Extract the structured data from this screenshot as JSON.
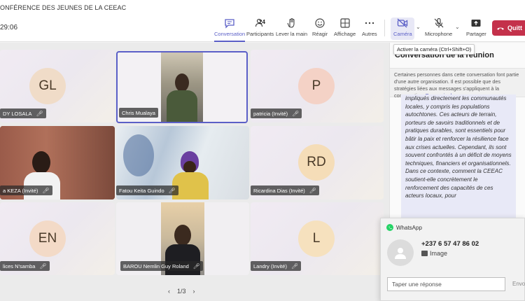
{
  "window": {
    "title": "ONFÉRENCE DES JEUNES DE LA CEEAC"
  },
  "toolbar": {
    "timer": "29:06",
    "items": [
      {
        "label": "Conversation",
        "icon": "chat-icon"
      },
      {
        "label": "Participants",
        "icon": "people-icon",
        "count": "24"
      },
      {
        "label": "Lever la main",
        "icon": "hand-icon"
      },
      {
        "label": "Réagir",
        "icon": "smile-icon"
      },
      {
        "label": "Affichage",
        "icon": "grid-icon"
      },
      {
        "label": "Autres",
        "icon": "more-icon"
      },
      {
        "label": "Caméra",
        "icon": "camera-off-icon"
      },
      {
        "label": "Microphone",
        "icon": "mic-off-icon"
      },
      {
        "label": "Partager",
        "icon": "share-icon"
      }
    ],
    "leave_label": "Quitt",
    "camera_tooltip": "Activer la caméra (Ctrl+Shift+O)"
  },
  "participants": [
    {
      "name": "DY LOSALA",
      "initials": "GL",
      "avatar_color": "#f0dcc8"
    },
    {
      "name": "Chris Mualaya",
      "initials": "",
      "video": true
    },
    {
      "name": "patricia (Invité)",
      "initials": "P",
      "avatar_color": "#f4d2c6"
    },
    {
      "name": "a KEZA (Invité)",
      "initials": "",
      "video": true
    },
    {
      "name": "Fatou Keita Guindo",
      "initials": "",
      "video": true
    },
    {
      "name": "Ricardina Dias (Invité)",
      "initials": "RD",
      "avatar_color": "#f5ddb8"
    },
    {
      "name": "lices N'samba",
      "initials": "EN",
      "avatar_color": "#f3dac7"
    },
    {
      "name": "BAROU Nemlin Guy Roland",
      "initials": "",
      "video": true
    },
    {
      "name": "Landry (Invité)",
      "initials": "L",
      "avatar_color": "#f6e1be"
    }
  ],
  "pager": {
    "text": "1/3"
  },
  "chat": {
    "title": "Conversation de la réunion",
    "notice": "Certaines personnes dans cette conversation font partie d'une autre organisation. Il est possible que des stratégies liées aux messages s'appliquent à la conversation.",
    "notice_link": "En savoir plus",
    "message": "impliqués directement les communautés locales, y compris les populations autochtones. Ces acteurs de terrain, porteurs de savoirs traditionnels et de pratiques durables, sont essentiels pour bâtir la paix et renforcer la résilience face aux crises actuelles. Cependant, ils sont souvent confrontés à un déficit de moyens techniques, financiers et organisationnels. Dans ce contexte, comment la CEEAC soutient-elle concrètement le renforcement des capacités de ces acteurs locaux, pour"
  },
  "whatsapp": {
    "app": "WhatsApp",
    "sender": "+237 6 57 47 86 02",
    "preview": "Image",
    "reply_placeholder": "Taper une réponse",
    "send_label": "Envo"
  },
  "colors": {
    "accent": "#5b5fc7",
    "leave": "#c4314b",
    "whatsapp": "#25d366"
  }
}
